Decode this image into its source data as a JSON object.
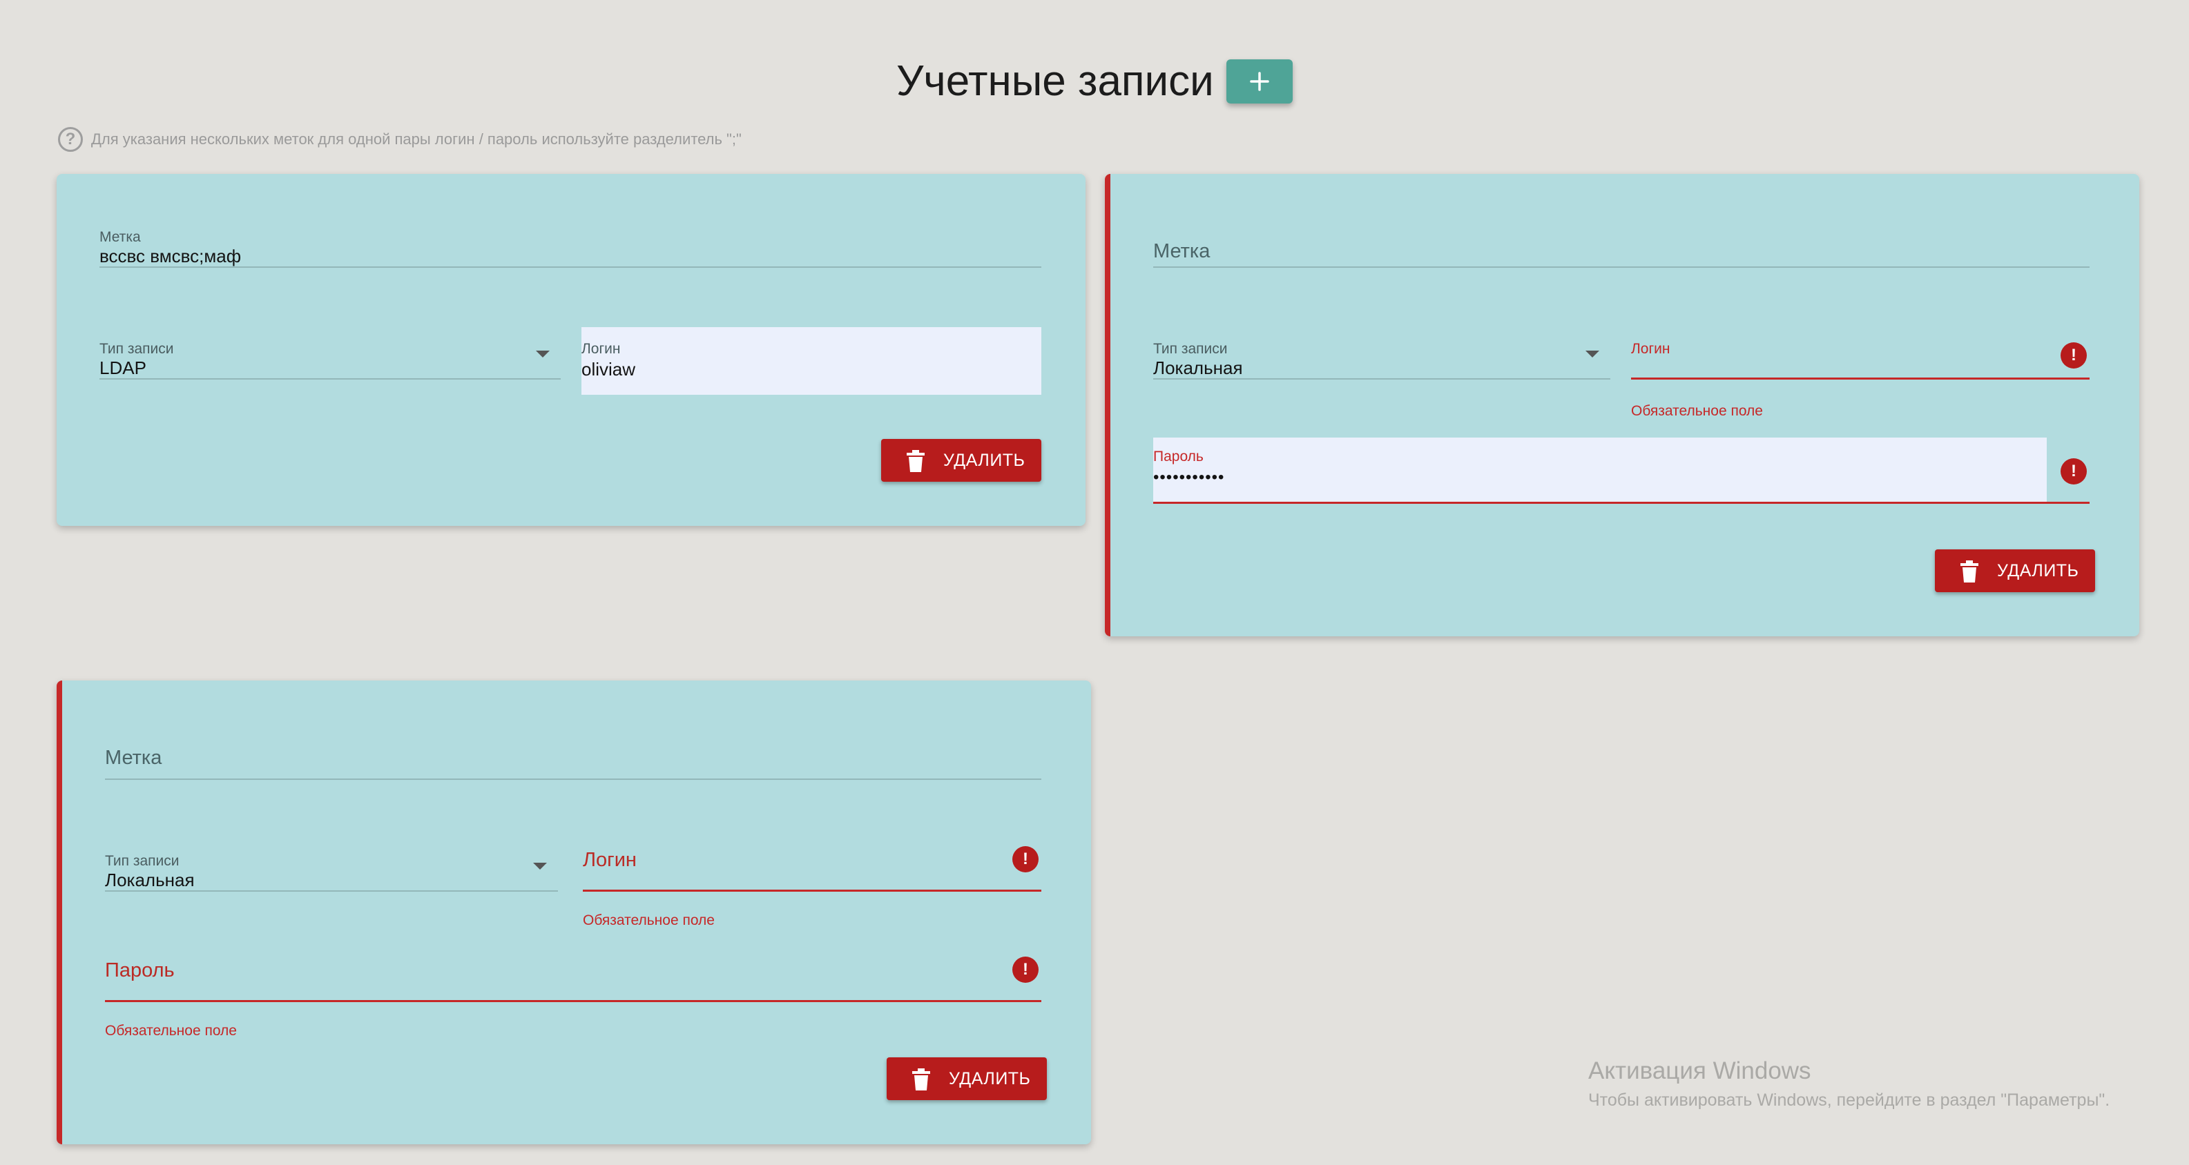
{
  "header": {
    "title": "Учетные записи",
    "hint": "Для указания нескольких меток для одной пары логин / пароль используйте разделитель \";\"",
    "hint_icon": "help-circle-icon",
    "add_icon": "plus-icon"
  },
  "colors": {
    "background": "#e3e1dd",
    "card": "#b2dcdf",
    "accent": "#4fa497",
    "error": "#c62828",
    "delete_button": "#b71c1c"
  },
  "accounts": [
    {
      "label_field": {
        "label": "Метка",
        "value": "вссвс  вмсвс;маф"
      },
      "type_field": {
        "label": "Тип записи",
        "value": "LDAP"
      },
      "login_field": {
        "label": "Логин",
        "value": "oliviaw"
      },
      "delete_label": "УДАЛИТЬ"
    },
    {
      "label_field": {
        "placeholder": "Метка"
      },
      "type_field": {
        "label": "Тип записи",
        "value": "Локальная"
      },
      "login_field": {
        "label": "Логин",
        "value": "",
        "error": "Обязательное поле"
      },
      "password_field": {
        "label": "Пароль",
        "value": "•••••••••••"
      },
      "delete_label": "УДАЛИТЬ"
    },
    {
      "label_field": {
        "placeholder": "Метка"
      },
      "type_field": {
        "label": "Тип записи",
        "value": "Локальная"
      },
      "login_field": {
        "placeholder": "Логин",
        "error": "Обязательное поле"
      },
      "password_field": {
        "placeholder": "Пароль",
        "error": "Обязательное поле"
      },
      "delete_label": "УДАЛИТЬ"
    }
  ],
  "watermark": {
    "title": "Активация Windows",
    "subtitle": "Чтобы активировать Windows, перейдите в раздел \"Параметры\"."
  }
}
